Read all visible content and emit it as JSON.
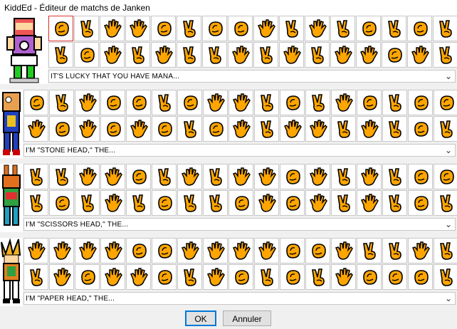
{
  "window": {
    "title": "KiddEd - Éditeur de matchs de Janken"
  },
  "icons": {
    "rock": "rock-hand-icon",
    "scissors": "scissors-hand-icon",
    "paper": "paper-hand-icon"
  },
  "colors": {
    "hand": "#ffa500",
    "outline": "#000000",
    "selection": "#dd3333"
  },
  "matches": [
    {
      "name": "match-1",
      "dialogue": "IT'S LUCKY THAT YOU HAVE MANA...",
      "rows": [
        [
          "rock",
          "scissors",
          "paper",
          "paper",
          "rock",
          "scissors",
          "rock",
          "rock",
          "paper",
          "scissors",
          "paper",
          "scissors",
          "rock",
          "scissors",
          "rock",
          "scissors"
        ],
        [
          "scissors",
          "rock",
          "paper",
          "scissors",
          "paper",
          "scissors",
          "scissors",
          "paper",
          "scissors",
          "paper",
          "scissors",
          "paper",
          "paper",
          "rock",
          "paper",
          "scissors"
        ]
      ]
    },
    {
      "name": "match-2",
      "dialogue": "I'M \"STONE HEAD,\" THE...",
      "rows": [
        [
          "rock",
          "scissors",
          "paper",
          "rock",
          "rock",
          "scissors",
          "rock",
          "paper",
          "paper",
          "scissors",
          "rock",
          "scissors",
          "paper",
          "rock",
          "scissors",
          "rock",
          "rock"
        ],
        [
          "paper",
          "rock",
          "paper",
          "rock",
          "paper",
          "rock",
          "scissors",
          "rock",
          "paper",
          "scissors",
          "paper",
          "paper",
          "scissors",
          "paper",
          "scissors",
          "rock",
          "scissors"
        ]
      ]
    },
    {
      "name": "match-3",
      "dialogue": "I'M \"SCISSORS HEAD,\" THE...",
      "rows": [
        [
          "scissors",
          "scissors",
          "paper",
          "paper",
          "rock",
          "scissors",
          "paper",
          "scissors",
          "paper",
          "paper",
          "rock",
          "paper",
          "scissors",
          "paper",
          "scissors",
          "rock",
          "rock"
        ],
        [
          "scissors",
          "rock",
          "scissors",
          "paper",
          "scissors",
          "rock",
          "scissors",
          "scissors",
          "rock",
          "paper",
          "rock",
          "paper",
          "scissors",
          "paper",
          "scissors",
          "rock",
          "scissors"
        ]
      ]
    },
    {
      "name": "match-4",
      "dialogue": "I'M \"PAPER HEAD,\" THE...",
      "rows": [
        [
          "paper",
          "paper",
          "paper",
          "paper",
          "rock",
          "rock",
          "paper",
          "paper",
          "paper",
          "paper",
          "rock",
          "rock",
          "paper",
          "scissors",
          "scissors",
          "paper",
          "scissors"
        ],
        [
          "scissors",
          "paper",
          "rock",
          "paper",
          "paper",
          "rock",
          "scissors",
          "paper",
          "rock",
          "scissors",
          "rock",
          "scissors",
          "paper",
          "rock",
          "rock",
          "rock",
          "scissors"
        ]
      ]
    }
  ],
  "buttons": {
    "ok": "OK",
    "cancel": "Annuler"
  }
}
